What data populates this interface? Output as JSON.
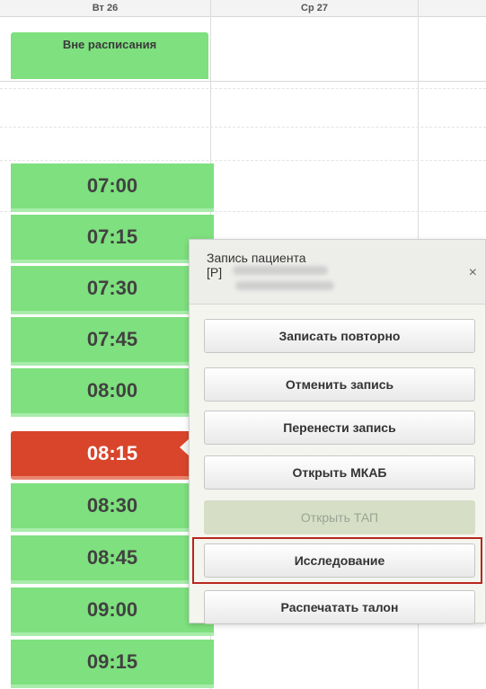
{
  "calendar": {
    "days": [
      {
        "label": "Вт 26"
      },
      {
        "label": "Ср 27"
      }
    ],
    "off_schedule_label": "Вне расписания",
    "slots": [
      "07:00",
      "07:15",
      "07:30",
      "07:45",
      "08:00",
      "08:15",
      "08:30",
      "08:45",
      "09:00",
      "09:15"
    ],
    "selected_slot": "08:15",
    "colors": {
      "free": "#7ee07e",
      "selected": "#d9452b"
    }
  },
  "popup": {
    "title": "Запись пациента",
    "subtitle": "[P]",
    "close_label": "×",
    "buttons": {
      "repeat": "Записать повторно",
      "cancel": "Отменить запись",
      "move": "Перенести запись",
      "open_mkab": "Открыть МКАБ",
      "open_tap": "Открыть ТАП",
      "research": "Исследование",
      "print": "Распечатать талон"
    },
    "highlight_color": "#b8271c"
  }
}
